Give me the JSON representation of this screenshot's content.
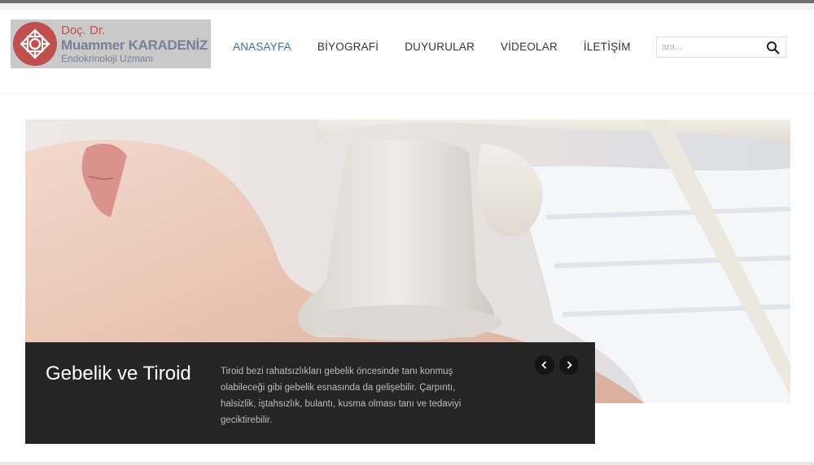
{
  "logo": {
    "line1": "Doç. Dr.",
    "line2": "Muammer KARADENİZ",
    "line3": "Endokrinoloji Uzmanı",
    "icon": "knot-emblem-icon"
  },
  "nav": {
    "items": [
      {
        "label": "ANASAYFA",
        "active": true
      },
      {
        "label": "BİYOGRAFİ",
        "active": false
      },
      {
        "label": "DUYURULAR",
        "active": false
      },
      {
        "label": "VİDEOLAR",
        "active": false
      },
      {
        "label": "İLETİŞİM",
        "active": false
      }
    ]
  },
  "search": {
    "placeholder": "ara...",
    "value": "",
    "icon": "search-icon"
  },
  "slider": {
    "image": "ultrasound-thyroid-exam-photo",
    "caption": {
      "title": "Gebelik ve Tiroid",
      "text": "Tiroid bezi rahatsızlıkları gebelik öncesinde tanı konmuş olabileceği gibi gebelik esnasında da gelişebilir. Çarpıntı, halsizlik, iştahsızlık, bulantı, kusma olması tanı ve tedaviyi geciktirebilir."
    },
    "prev_icon": "chevron-left-icon",
    "next_icon": "chevron-right-icon"
  },
  "colors": {
    "accent": "#3a6fa8",
    "logo_red": "#c0504d",
    "logo_slate": "#7a7f96",
    "caption_bg": "#252525"
  }
}
